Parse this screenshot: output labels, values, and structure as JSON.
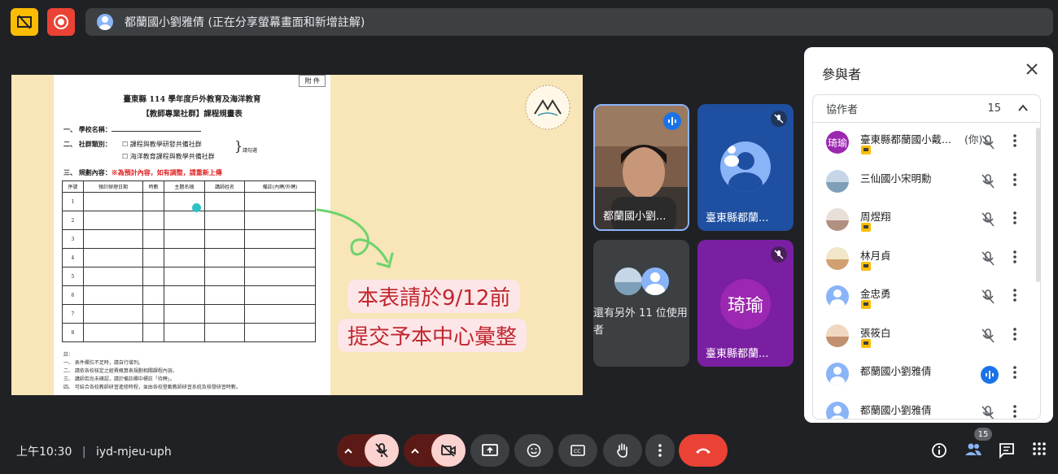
{
  "banner": {
    "text": "都蘭國小劉雅倩 (正在分享螢幕畫面和新增註解)"
  },
  "shared_screen": {
    "attachment_tag": "附 件",
    "title_line1": "臺東縣 114 學年度戶外教育及海洋教育",
    "title_line2": "【教師專業社群】課程規畫表",
    "field_school": "一、 學校名稱：",
    "field_type": "二、 社群類別：",
    "option1": "☐ 課程與教學研發共備社群",
    "option2": "☐ 海洋教育課程與教學共備社群",
    "option_hint": "請勾選",
    "field_plan": "三、 規劃內容：",
    "plan_note": "※為預計內容，如有調整，請重新上傳",
    "columns": [
      "序號",
      "預計辦理日期",
      "時數",
      "主題名稱",
      "講師姓名",
      "備註(內聘/外聘)"
    ],
    "row_numbers": [
      "1",
      "2",
      "3",
      "4",
      "5",
      "6",
      "7",
      "8"
    ],
    "notes": [
      "註：",
      "一、 表件欄位不足時，請自行增列。",
      "二、 請依各校核定之經費概算表規劃相關課程內容。",
      "三、 講師若尚未確認，請於備註欄中標註「待聘」。",
      "四、 可結合各校教師研習進修時程，並由各校登載教師研習系統及核發研習時數。"
    ],
    "annotation_line1": "本表請於9/12前",
    "annotation_line2": "提交予本中心彙整"
  },
  "tiles": [
    {
      "name": "都蘭國小劉...",
      "state": "speaking"
    },
    {
      "name": "臺東縣都蘭...",
      "state": "muted"
    },
    {
      "name": "還有另外 11 位使用者",
      "state": "group"
    },
    {
      "name": "臺東縣都蘭...",
      "avatar_text": "琦瑜",
      "state": "muted"
    }
  ],
  "panel": {
    "title": "參與者",
    "section_label": "協作者",
    "section_count": "15",
    "participants": [
      {
        "name": "臺東縣都蘭國小戴...",
        "suffix": "(你)",
        "avatar_text": "琦瑜",
        "host": true,
        "mic": "muted"
      },
      {
        "name": "三仙國小宋明勳",
        "host": false,
        "mic": "muted"
      },
      {
        "name": "周煜翔",
        "host": true,
        "mic": "muted"
      },
      {
        "name": "林月貞",
        "host": true,
        "mic": "muted"
      },
      {
        "name": "金忠勇",
        "host": true,
        "mic": "muted"
      },
      {
        "name": "張筱白",
        "host": true,
        "mic": "muted"
      },
      {
        "name": "都蘭國小劉雅倩",
        "host": false,
        "mic": "speaking"
      },
      {
        "name": "都蘭國小劉雅倩",
        "host": false,
        "mic": "off"
      }
    ]
  },
  "bottom": {
    "time": "上午10:30",
    "meeting_code": "iyd-mjeu-uph",
    "people_count": "15"
  },
  "colors": {
    "end_call": "#ea4335",
    "muted_bg": "#fad2cf",
    "accent": "#1a73e8",
    "record": "#ea4335",
    "host_badge": "#fbbc04"
  }
}
